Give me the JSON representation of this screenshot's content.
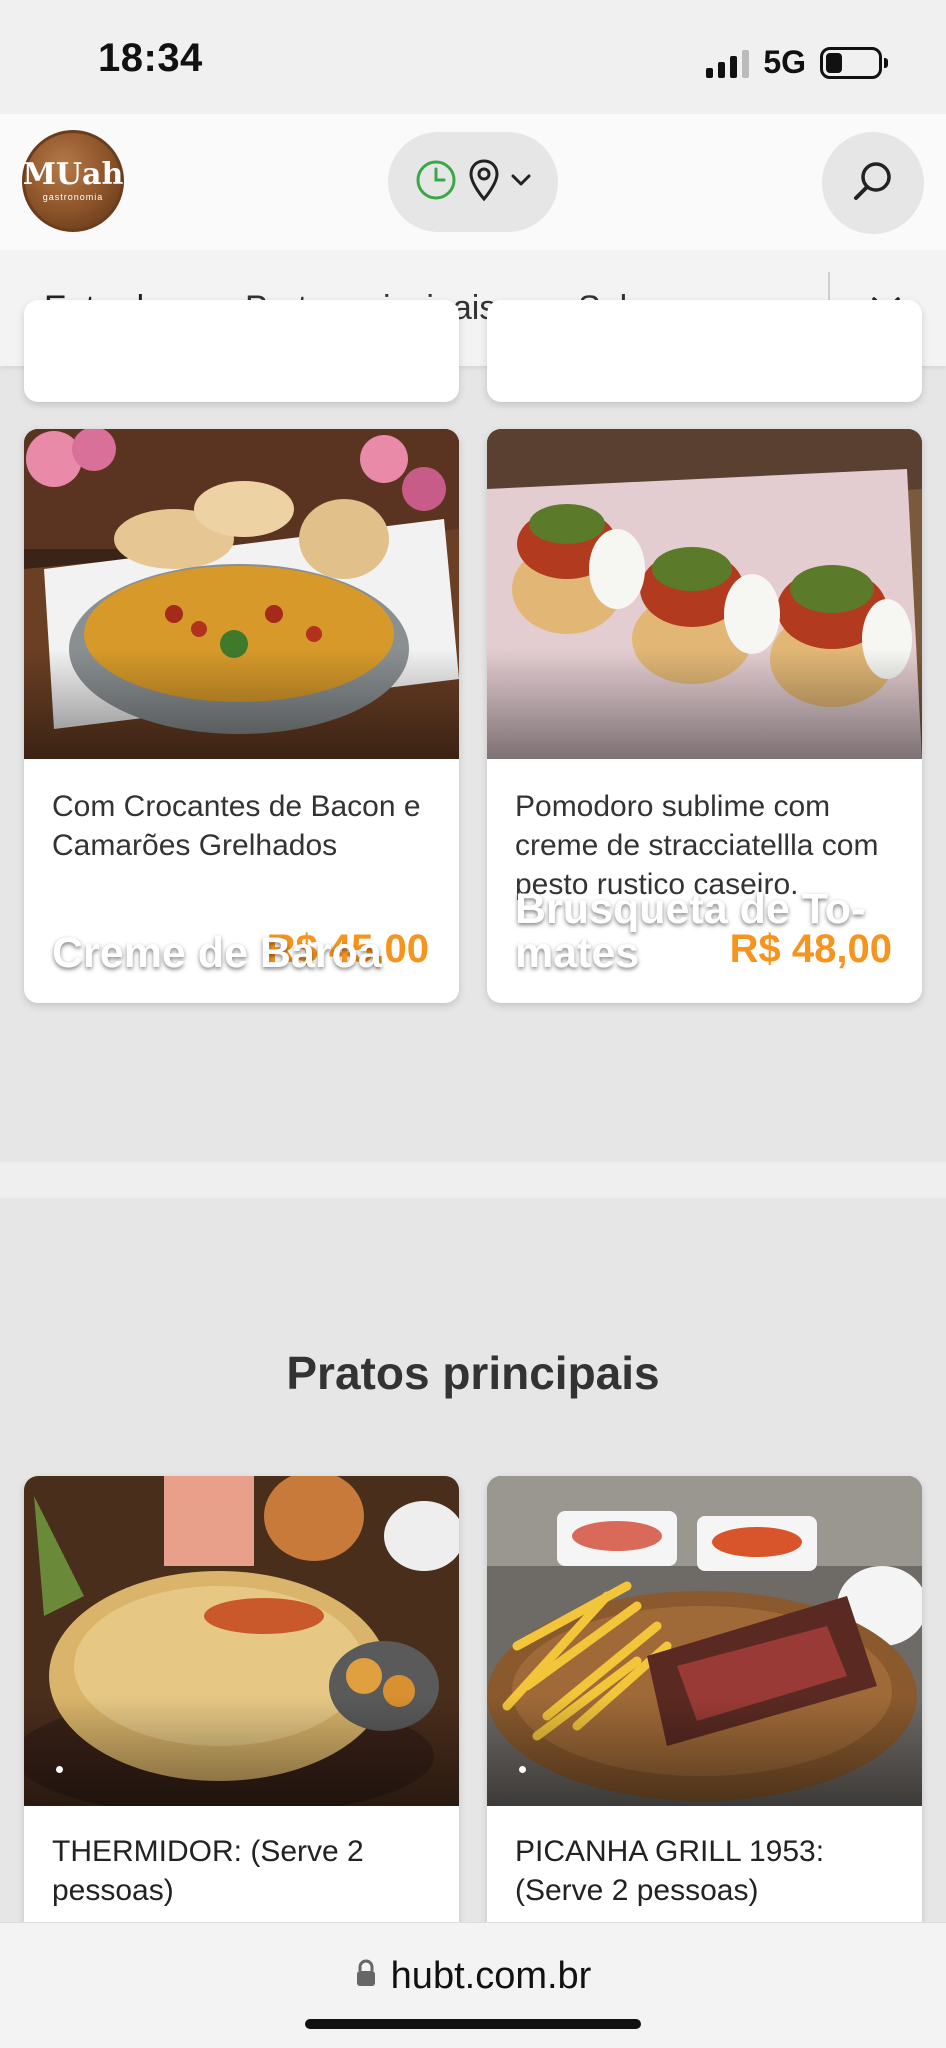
{
  "status_bar": {
    "time": "18:34",
    "network": "5G"
  },
  "header": {
    "logo_name": "MUah",
    "logo_sub": "gastronomia",
    "icons": [
      "clock-icon",
      "location-pin-icon",
      "chevron-down-icon",
      "search-icon"
    ]
  },
  "tabs": [
    {
      "label": "Entradas",
      "active": true
    },
    {
      "label": "Pratos principais",
      "active": false
    },
    {
      "label": "Sobremesas",
      "active": false
    }
  ],
  "entradas": [
    {
      "title": "Creme de Baroa",
      "description": "Com Crocantes de Bacon e Camarões Grelhados",
      "price": "R$ 45,00"
    },
    {
      "title": "Brusqueta de To-mates",
      "description": "Pomodoro sublime com creme de stracciatellla com pesto rustico caseiro.",
      "price": "R$ 48,00"
    }
  ],
  "section_title": "Pratos principais",
  "pratos": [
    {
      "description": "THERMIDOR: (Serve 2 pessoas)"
    },
    {
      "description": "PICANHA GRILL 1953: (Serve 2 pessoas)"
    }
  ],
  "browser": {
    "url": "hubt.com.br"
  },
  "colors": {
    "price": "#f7941d",
    "clock": "#3aa84a"
  }
}
